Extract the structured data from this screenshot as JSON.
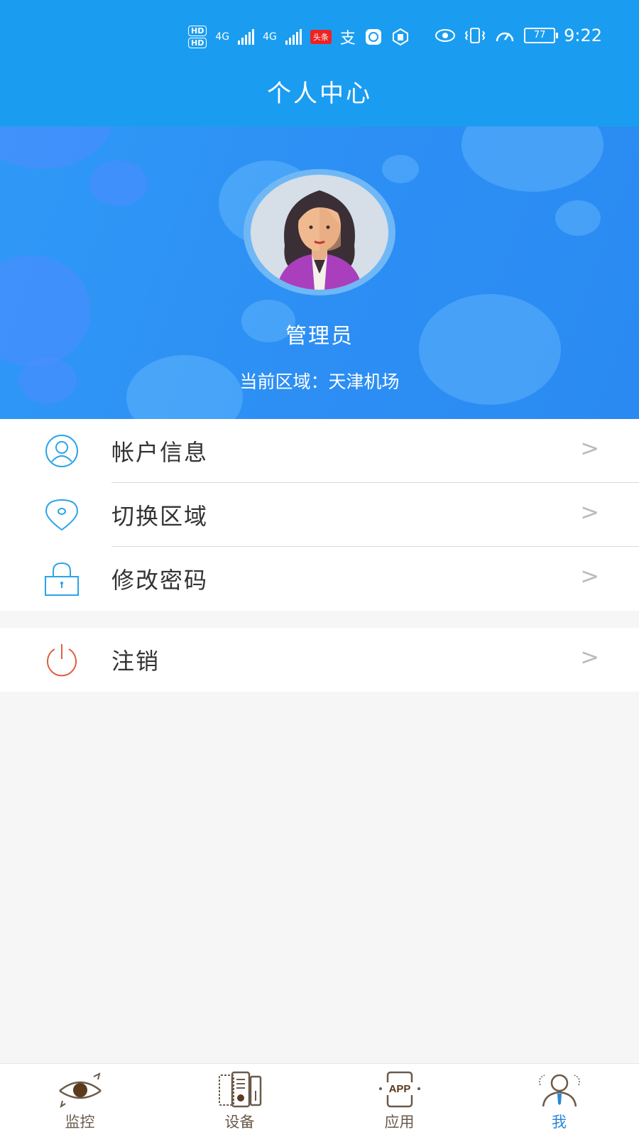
{
  "status_bar": {
    "hd1": "HD",
    "hd2": "HD",
    "net1": "4G",
    "net2": "4G",
    "news_badge": "头条",
    "alipay_glyph": "支",
    "battery": "77",
    "time": "9:22"
  },
  "header": {
    "title": "个人中心"
  },
  "profile": {
    "name": "管理员",
    "region": "当前区域：天津机场"
  },
  "menu": {
    "items": [
      {
        "label": "帐户信息",
        "icon": "user-icon",
        "chevron": ">"
      },
      {
        "label": "切换区域",
        "icon": "location-pin-icon",
        "chevron": ">"
      },
      {
        "label": "修改密码",
        "icon": "lock-icon",
        "chevron": ">"
      }
    ],
    "logout": {
      "label": "注销",
      "icon": "power-icon",
      "chevron": ">"
    }
  },
  "tabbar": {
    "active": "我",
    "tabs": [
      {
        "label": "监控",
        "icon": "monitor-eye-icon"
      },
      {
        "label": "设备",
        "icon": "device-icon"
      },
      {
        "label": "应用",
        "icon": "app-icon",
        "icon_text": "APP"
      },
      {
        "label": "我",
        "icon": "person-icon"
      }
    ]
  },
  "colors": {
    "primary": "#1a9df0",
    "hero": "#2d8ff4",
    "icon_blue": "#2aa4e8",
    "logout_red": "#e0603e",
    "tab_active": "#2a86d8",
    "tab_inactive": "#6b5a4a"
  }
}
